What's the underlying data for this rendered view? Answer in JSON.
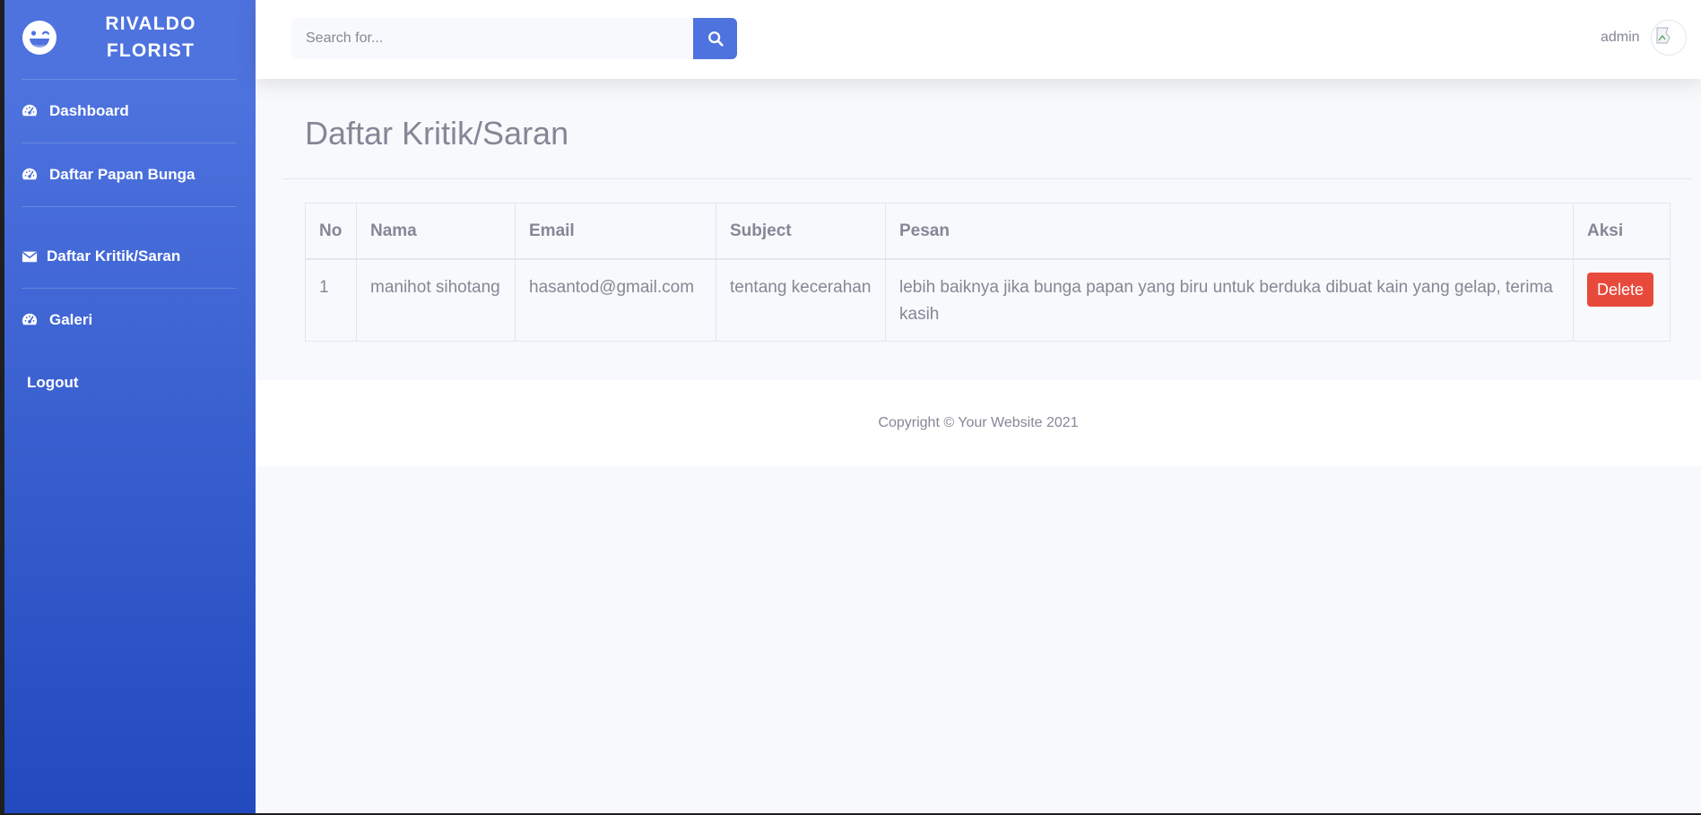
{
  "sidebar": {
    "brand": {
      "line1": "RIVALDO",
      "line2": "FLORIST",
      "icon": "laugh-wink-icon"
    },
    "items": [
      {
        "label": "Dashboard",
        "icon": "tachometer-icon"
      },
      {
        "label": "Daftar Papan Bunga",
        "icon": "tachometer-icon"
      },
      {
        "label": "Daftar Kritik/Saran",
        "icon": "envelope-icon"
      },
      {
        "label": "Galeri",
        "icon": "tachometer-icon"
      },
      {
        "label": "Logout"
      }
    ]
  },
  "topbar": {
    "search": {
      "placeholder": "Search for..."
    },
    "user": {
      "name": "admin"
    }
  },
  "main": {
    "title": "Daftar Kritik/Saran",
    "table": {
      "columns": [
        "No",
        "Nama",
        "Email",
        "Subject",
        "Pesan",
        "Aksi"
      ],
      "rows": [
        {
          "no": "1",
          "nama": "manihot sihotang",
          "email": "hasantod@gmail.com",
          "subject": "tentang kecerahan",
          "pesan": "lebih baiknya jika bunga papan yang biru untuk berduka dibuat kain yang gelap, terima kasih",
          "action": "Delete"
        }
      ]
    }
  },
  "footer": {
    "text": "Copyright © Your Website 2021"
  },
  "colors": {
    "primary": "#4e73df",
    "primary_dark": "#224abe",
    "danger": "#e74a3b",
    "text_muted": "#858796"
  }
}
